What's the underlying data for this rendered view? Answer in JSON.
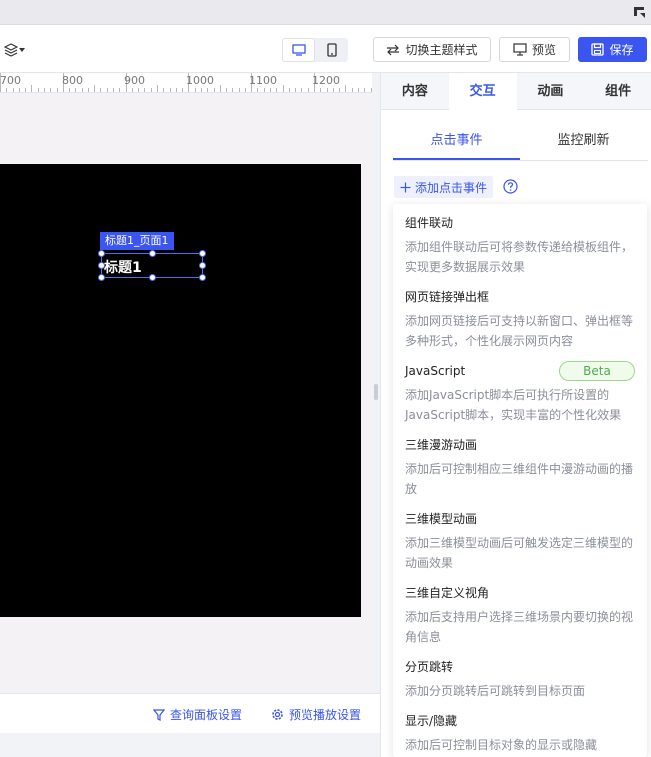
{
  "toolbar": {
    "theme_label": "切换主题样式",
    "preview_label": "预览",
    "save_label": "保存",
    "accent_color": "#3a55f0"
  },
  "ruler": {
    "labels": [
      "700",
      "800",
      "900",
      "1000",
      "1100",
      "1200"
    ]
  },
  "canvas": {
    "selected_tag": "标题1_页面1",
    "selected_text": "标题1"
  },
  "bottom": {
    "query_panel_label": "查询面板设置",
    "playback_label": "预览播放设置"
  },
  "panel": {
    "tabs": [
      {
        "label": "内容"
      },
      {
        "label": "交互"
      },
      {
        "label": "动画"
      },
      {
        "label": "组件"
      }
    ],
    "active_tab": "交互",
    "subtabs": [
      {
        "label": "点击事件"
      },
      {
        "label": "监控刷新"
      }
    ],
    "add_event_label": "添加点击事件",
    "options": [
      {
        "title": "组件联动",
        "desc": "添加组件联动后可将参数传递给模板组件，实现更多数据展示效果"
      },
      {
        "title": "网页链接弹出框",
        "desc": "添加网页链接后可支持以新窗口、弹出框等多种形式，个性化展示网页内容"
      },
      {
        "title": "JavaScript",
        "badge": "Beta",
        "desc": "添加JavaScript脚本后可执行所设置的JavaScript脚本，实现丰富的个性化效果"
      },
      {
        "title": "三维漫游动画",
        "desc": "添加后可控制相应三维组件中漫游动画的播放"
      },
      {
        "title": "三维模型动画",
        "desc": "添加三维模型动画后可触发选定三维模型的动画效果"
      },
      {
        "title": "三维自定义视角",
        "desc": "添加后支持用户选择三维场景内要切换的视角信息"
      },
      {
        "title": "分页跳转",
        "desc": "添加分页跳转后可跳转到目标页面"
      },
      {
        "title": "显示/隐藏",
        "desc": "添加后可控制目标对象的显示或隐藏"
      }
    ]
  }
}
